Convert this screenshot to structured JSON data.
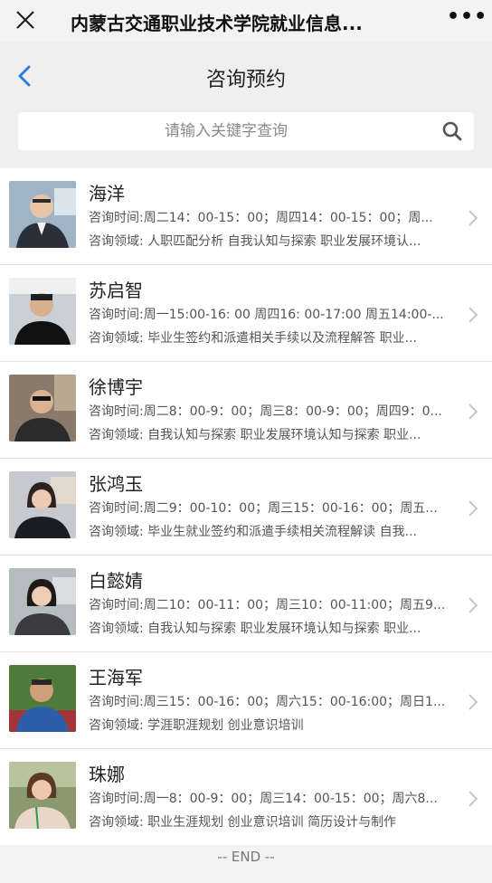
{
  "window": {
    "title": "内蒙古交通职业技术学院就业信息...",
    "close_icon": "close-icon",
    "more_icon": "more-icon",
    "more_label": "•••"
  },
  "header": {
    "title": "咨询预约",
    "back_icon": "back-arrow-icon",
    "accent": "#2a7de1"
  },
  "search": {
    "placeholder": "请输入关键字查询",
    "icon": "search-icon"
  },
  "list": [
    {
      "name": "海洋",
      "time": "咨询时间:周二14：00-15：00；周四14：00-15：00；周...",
      "field": "咨询领域: 人职匹配分析 自我认知与探索 职业发展环境认..."
    },
    {
      "name": "苏启智",
      "time": "咨询时间:周一15:00-16: 00 周四16: 00-17:00 周五14:00-...",
      "field": "咨询领域: 毕业生签约和派遣相关手续以及流程解答 职业..."
    },
    {
      "name": "徐博宇",
      "time": "咨询时间:周二8：00-9：00；周三8：00-9：00；周四9：0...",
      "field": "咨询领域: 自我认知与探索 职业发展环境认知与探索 职业..."
    },
    {
      "name": "张鸿玉",
      "time": "咨询时间:周二9：00-10：00；周三15：00-16：00；周五...",
      "field": "咨询领域: 毕业生就业签约和派遣手续相关流程解读 自我..."
    },
    {
      "name": "白懿婧",
      "time": "咨询时间:周二10：00-11：00；周三10：00-11:00；周五9...",
      "field": "咨询领域: 自我认知与探索 职业发展环境认知与探索 职业..."
    },
    {
      "name": "王海军",
      "time": "咨询时间:周三15：00-16：00；周六15：00-16:00；周日1...",
      "field": "咨询领域: 学涯职涯规划 创业意识培训"
    },
    {
      "name": "珠娜",
      "time": "咨询时间:周一8：00-9：00；周三14：00-15：00；周六8...",
      "field": "咨询领域: 职业生涯规划 创业意识培训 简历设计与制作"
    }
  ],
  "footer": {
    "end_label": "-- END --"
  }
}
